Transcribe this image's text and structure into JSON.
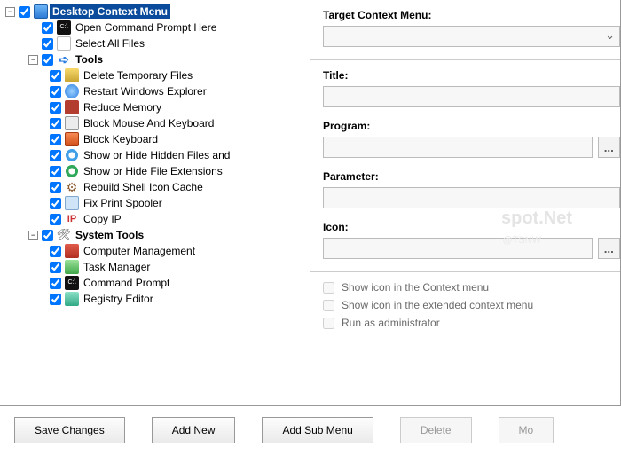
{
  "tree": {
    "root": {
      "label": "Desktop Context Menu"
    },
    "root_items": [
      {
        "label": "Open Command Prompt Here"
      },
      {
        "label": "Select All Files"
      }
    ],
    "tools": {
      "label": "Tools"
    },
    "tools_items": [
      {
        "label": "Delete Temporary Files"
      },
      {
        "label": "Restart Windows Explorer"
      },
      {
        "label": "Reduce Memory"
      },
      {
        "label": "Block Mouse And Keyboard"
      },
      {
        "label": "Block Keyboard"
      },
      {
        "label": "Show or Hide Hidden Files and"
      },
      {
        "label": "Show or Hide File Extensions"
      },
      {
        "label": "Rebuild Shell Icon Cache"
      },
      {
        "label": "Fix Print Spooler"
      },
      {
        "label": "Copy IP"
      }
    ],
    "system": {
      "label": "System Tools"
    },
    "system_items": [
      {
        "label": "Computer Management"
      },
      {
        "label": "Task Manager"
      },
      {
        "label": "Command Prompt"
      },
      {
        "label": "Registry Editor"
      }
    ]
  },
  "form": {
    "target_label": "Target Context Menu:",
    "title_label": "Title:",
    "program_label": "Program:",
    "parameter_label": "Parameter:",
    "icon_label": "Icon:",
    "target_value": "",
    "title_value": "",
    "program_value": "",
    "parameter_value": "",
    "icon_value": "",
    "browse": "...",
    "check1": "Show icon in the Context menu",
    "check2": "Show icon in the extended context menu",
    "check3": "Run as administrator"
  },
  "buttons": {
    "save": "Save Changes",
    "add": "Add New",
    "submenu": "Add Sub Menu",
    "delete": "Delete",
    "more": "Mo"
  },
  "watermark": {
    "a": "spot.Net",
    "b": "@TSNW"
  }
}
